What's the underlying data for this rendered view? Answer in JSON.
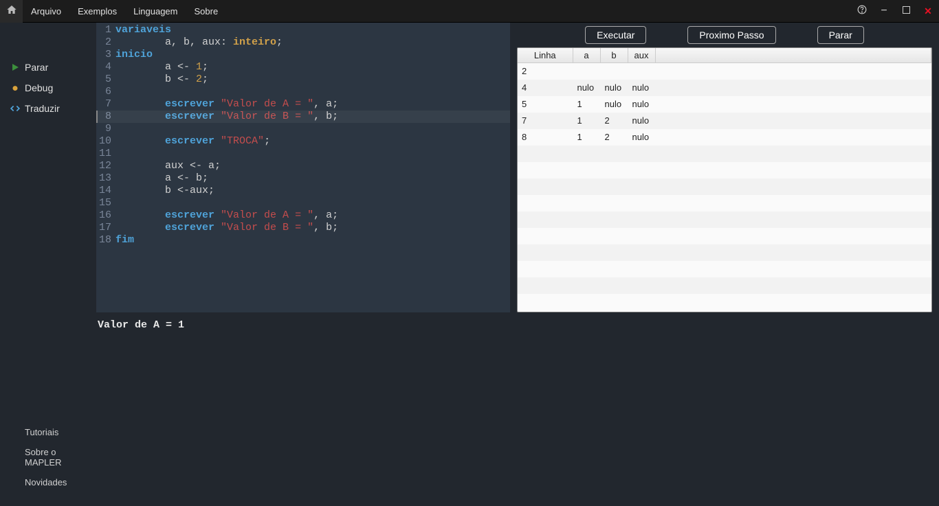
{
  "menu": {
    "items": [
      "Arquivo",
      "Exemplos",
      "Linguagem",
      "Sobre"
    ]
  },
  "sidebar": {
    "items": [
      {
        "label": "Parar",
        "icon": "play",
        "color": "#3c8f3c"
      },
      {
        "label": "Debug",
        "icon": "bug",
        "color": "#d9a23c"
      },
      {
        "label": "Traduzir",
        "icon": "code",
        "color": "#4fa3d9"
      }
    ],
    "bottom": [
      "Tutoriais",
      "Sobre o MAPLER",
      "Novidades"
    ]
  },
  "editor": {
    "highlighted_line": 8,
    "lines": [
      {
        "n": 1,
        "tokens": [
          {
            "t": "variaveis",
            "c": "kw"
          }
        ]
      },
      {
        "n": 2,
        "tokens": [
          {
            "t": "        a, b, aux: ",
            "c": ""
          },
          {
            "t": "inteiro",
            "c": "type"
          },
          {
            "t": ";",
            "c": ""
          }
        ]
      },
      {
        "n": 3,
        "tokens": [
          {
            "t": "inicio",
            "c": "kw"
          }
        ]
      },
      {
        "n": 4,
        "tokens": [
          {
            "t": "        a <- ",
            "c": ""
          },
          {
            "t": "1",
            "c": "num"
          },
          {
            "t": ";",
            "c": ""
          }
        ]
      },
      {
        "n": 5,
        "tokens": [
          {
            "t": "        b <- ",
            "c": ""
          },
          {
            "t": "2",
            "c": "num"
          },
          {
            "t": ";",
            "c": ""
          }
        ]
      },
      {
        "n": 6,
        "tokens": []
      },
      {
        "n": 7,
        "tokens": [
          {
            "t": "        ",
            "c": ""
          },
          {
            "t": "escrever",
            "c": "fn"
          },
          {
            "t": " ",
            "c": ""
          },
          {
            "t": "\"Valor de A = \"",
            "c": "str"
          },
          {
            "t": ", a;",
            "c": ""
          }
        ]
      },
      {
        "n": 8,
        "tokens": [
          {
            "t": "        ",
            "c": ""
          },
          {
            "t": "escrever",
            "c": "fn"
          },
          {
            "t": " ",
            "c": ""
          },
          {
            "t": "\"Valor de B = \"",
            "c": "str"
          },
          {
            "t": ", b;",
            "c": ""
          }
        ]
      },
      {
        "n": 9,
        "tokens": []
      },
      {
        "n": 10,
        "tokens": [
          {
            "t": "        ",
            "c": ""
          },
          {
            "t": "escrever",
            "c": "fn"
          },
          {
            "t": " ",
            "c": ""
          },
          {
            "t": "\"TROCA\"",
            "c": "str"
          },
          {
            "t": ";",
            "c": ""
          }
        ]
      },
      {
        "n": 11,
        "tokens": []
      },
      {
        "n": 12,
        "tokens": [
          {
            "t": "        aux <- a;",
            "c": ""
          }
        ]
      },
      {
        "n": 13,
        "tokens": [
          {
            "t": "        a <- b;",
            "c": ""
          }
        ]
      },
      {
        "n": 14,
        "tokens": [
          {
            "t": "        b <-aux;",
            "c": ""
          }
        ]
      },
      {
        "n": 15,
        "tokens": []
      },
      {
        "n": 16,
        "tokens": [
          {
            "t": "        ",
            "c": ""
          },
          {
            "t": "escrever",
            "c": "fn"
          },
          {
            "t": " ",
            "c": ""
          },
          {
            "t": "\"Valor de A = \"",
            "c": "str"
          },
          {
            "t": ", a;",
            "c": ""
          }
        ]
      },
      {
        "n": 17,
        "tokens": [
          {
            "t": "        ",
            "c": ""
          },
          {
            "t": "escrever",
            "c": "fn"
          },
          {
            "t": " ",
            "c": ""
          },
          {
            "t": "\"Valor de B = \"",
            "c": "str"
          },
          {
            "t": ", b;",
            "c": ""
          }
        ]
      },
      {
        "n": 18,
        "tokens": [
          {
            "t": "fim",
            "c": "kw"
          }
        ]
      }
    ]
  },
  "controls": {
    "executar": "Executar",
    "proximo": "Proximo Passo",
    "parar": "Parar"
  },
  "vartable": {
    "headers": [
      "Linha",
      "a",
      "b",
      "aux"
    ],
    "rows": [
      {
        "linha": "2",
        "a": "",
        "b": "",
        "aux": ""
      },
      {
        "linha": "4",
        "a": "nulo",
        "b": "nulo",
        "aux": "nulo"
      },
      {
        "linha": "5",
        "a": "1",
        "b": "nulo",
        "aux": "nulo"
      },
      {
        "linha": "7",
        "a": "1",
        "b": "2",
        "aux": "nulo"
      },
      {
        "linha": "8",
        "a": "1",
        "b": "2",
        "aux": "nulo"
      }
    ],
    "blank_rows": 10
  },
  "console": {
    "output": "Valor de A = 1"
  }
}
